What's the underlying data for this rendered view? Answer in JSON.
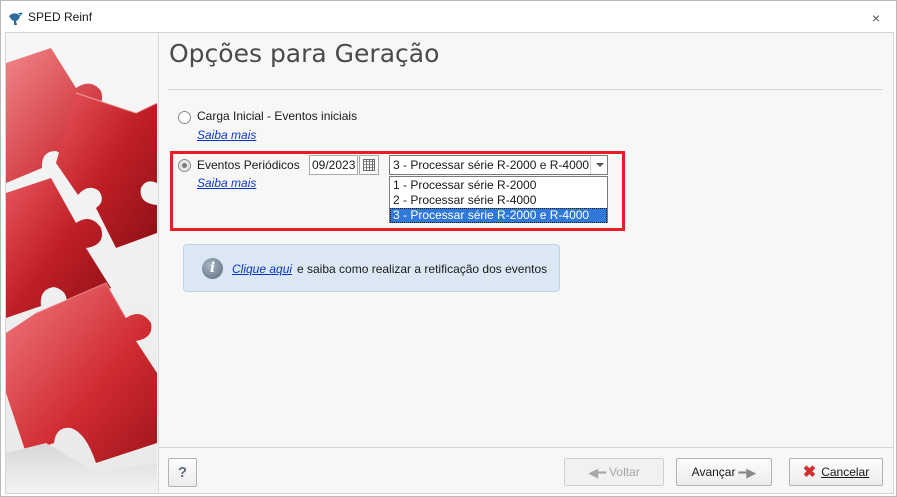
{
  "window": {
    "title": "SPED Reinf",
    "close_glyph": "×",
    "app_icon": "bird-logo-icon"
  },
  "page": {
    "title": "Opções para Geração"
  },
  "options": {
    "initial_load": {
      "label": "Carga Inicial - Eventos iniciais",
      "learn_more": "Saiba mais",
      "selected": false
    },
    "periodic": {
      "label": "Eventos Periódicos",
      "learn_more": "Saiba mais",
      "selected": true,
      "period_value": "09/2023",
      "combo_value": "3 - Processar série R-2000 e R-4000",
      "dropdown_items": [
        "1 - Processar série R-2000",
        "2 - Processar série R-4000",
        "3 - Processar série R-2000 e R-4000"
      ],
      "dropdown_selected_index": 2
    }
  },
  "info": {
    "icon": "info-icon",
    "link_text": "Clique aqui ",
    "text": "e saiba como realizar a retificação dos eventos"
  },
  "footer": {
    "help_label": "?",
    "back_label": "Voltar",
    "back_enabled": false,
    "next_label": "Avançar",
    "cancel_label": "Cancelar"
  },
  "colors": {
    "highlight_border": "#e81d25",
    "link": "#0b35c9",
    "selection": "#3079d8",
    "info_background": "#dbe8f4"
  }
}
